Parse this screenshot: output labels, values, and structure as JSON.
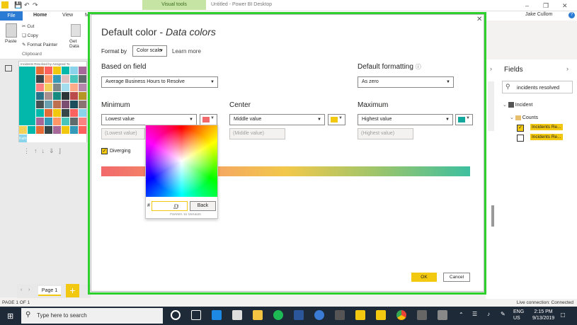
{
  "app": {
    "title": "Untitled - Power BI Desktop",
    "contextual_tab": "Visual tools",
    "user": "Jake Cullom",
    "tabs": [
      "File",
      "Home",
      "View",
      "M"
    ],
    "ribbon": {
      "paste": "Paste",
      "cut": "Cut",
      "copy": "Copy",
      "format_painter": "Format Painter",
      "clipboard": "Clipboard",
      "get_data": "Get Data"
    }
  },
  "thumbnail": {
    "title": "Incidents Resolved by Assigned To",
    "label": "Kathy S"
  },
  "pages": {
    "page1": "Page 1",
    "add": "+"
  },
  "status": {
    "left": "PAGE 1 OF 1",
    "right": "Live connection: Connected"
  },
  "fields_pane": {
    "title": "Fields",
    "search_value": "incidents resolved",
    "table": "Incident",
    "group": "Counts",
    "item1": "Incidents Re...",
    "item2": "Incidents Re..."
  },
  "dialog": {
    "title_main": "Default color - ",
    "title_sub": "Data colors",
    "format_by_label": "Format by",
    "format_by_value": "Color scale",
    "learn_more": "Learn more",
    "based_on_label": "Based on field",
    "based_on_value": "Average Business Hours to Resolve",
    "default_formatting_label": "Default formatting",
    "default_formatting_value": "As zero",
    "minimum": {
      "label": "Minimum",
      "select": "Lowest value",
      "placeholder": "(Lowest value)",
      "color": "#f2696b"
    },
    "center": {
      "label": "Center",
      "select": "Middle value",
      "placeholder": "(Middle value)",
      "color": "#f2c811"
    },
    "maximum": {
      "label": "Maximum",
      "select": "Highest value",
      "placeholder": "(Highest value)",
      "color": "#13a89e"
    },
    "diverging": "Diverging",
    "picker": {
      "hash": "#",
      "back": "Back",
      "hidden_text": "Revert to default"
    },
    "ok": "OK",
    "cancel": "Cancel"
  },
  "taskbar": {
    "search_placeholder": "Type here to search",
    "lang1": "ENG",
    "lang2": "US",
    "time": "2:15 PM",
    "date": "9/13/2019"
  }
}
